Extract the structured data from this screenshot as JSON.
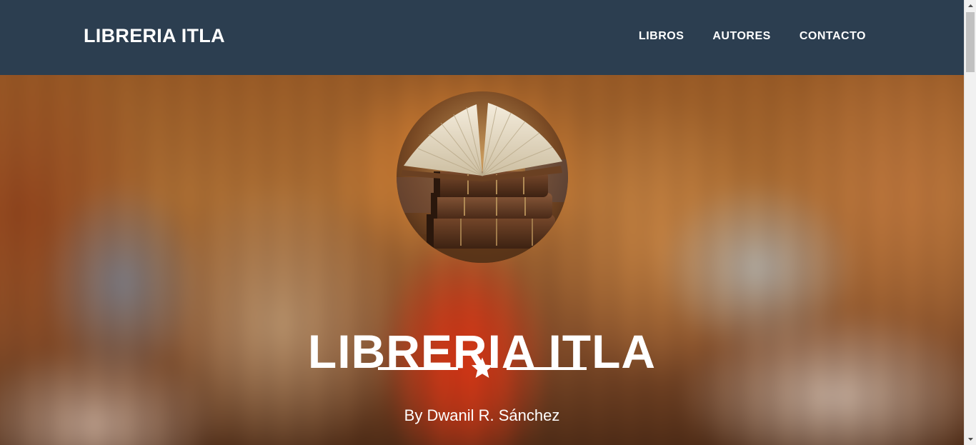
{
  "navbar": {
    "brand": "LIBRERIA ITLA",
    "links": [
      {
        "label": "LIBROS"
      },
      {
        "label": "AUTORES"
      },
      {
        "label": "CONTACTO"
      }
    ]
  },
  "hero": {
    "avatar_icon": "open-book-stack-image",
    "title": "LIBRERIA ITLA",
    "divider_icon": "star-icon",
    "subtitle": "By Dwanil R. Sánchez"
  },
  "colors": {
    "navbar_bg": "#2c3e50",
    "text": "#ffffff",
    "accent_red": "#e53a18"
  }
}
